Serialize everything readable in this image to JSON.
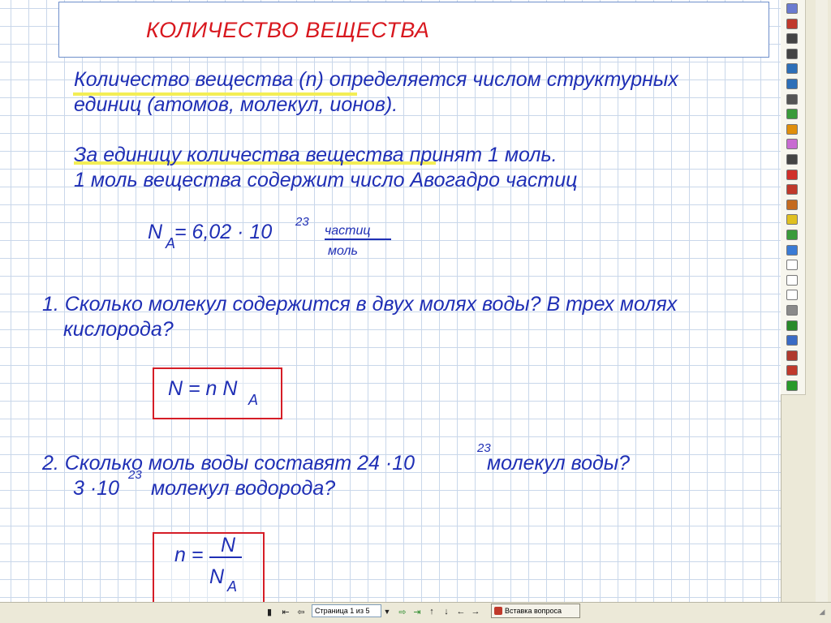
{
  "slide": {
    "title": "КОЛИЧЕСТВО     ВЕЩЕСТВА",
    "definition_line1": "Количество  вещества (n)  определяется  числом структурных",
    "definition_line2": "единиц (атомов, молекул, ионов).",
    "unit_line1": "За единицу количества вещества принят 1 моль.",
    "unit_line2": "1 моль вещества содержит число Авогадро частиц",
    "avogadro": {
      "symbol": "N",
      "subscript": "A",
      "value": " = 6,02 · 10",
      "exponent": "23",
      "unit_numerator": "частиц",
      "unit_denominator": "моль"
    },
    "question1_line1": "1. Сколько молекул содержится в двух молях воды? В трех молях",
    "question1_line2": "кислорода?",
    "formula1": {
      "text": "N = n N",
      "subscript": "A"
    },
    "question2_line1_a": "2. Сколько моль  воды  составят   24 ·10",
    "question2_exponent1": "23",
    "question2_line1_b": "молекул воды?",
    "question2_line2_a": "3 ·10",
    "question2_exponent2": "23",
    "question2_line2_b": "молекул водорода?",
    "formula2": {
      "lhs": "n =",
      "numerator": "N",
      "denominator": "N",
      "subscript": "A"
    }
  },
  "toolbar": {
    "icons": [
      "toolbar-logo-icon",
      "palette-icon",
      "hand-icon",
      "mouse-icon",
      "text-tool-icon",
      "number-tool-icon",
      "ruler-icon",
      "marker-icon",
      "pencil-icon",
      "eraser-icon",
      "pointer-icon",
      "undo-icon",
      "delete-icon",
      "stamp-icon",
      "magic-wand-icon",
      "screen-capture-icon",
      "screen-camera-icon",
      "new-page-icon",
      "grid-page-icon",
      "graph-page-icon",
      "back-arrow-icon",
      "forward-arrow-icon",
      "video-icon",
      "toolbox-icon",
      "recorder-icon",
      "battery-icon"
    ]
  },
  "bottom_bar": {
    "page_indicator": "Страница 1 из 5",
    "insert_question": "Вставка вопроса"
  },
  "colors": {
    "blue_text": "#1f2fb5",
    "red_text": "#d8171e",
    "highlight": "#f3ee55",
    "grid": "#c9d7ea"
  }
}
